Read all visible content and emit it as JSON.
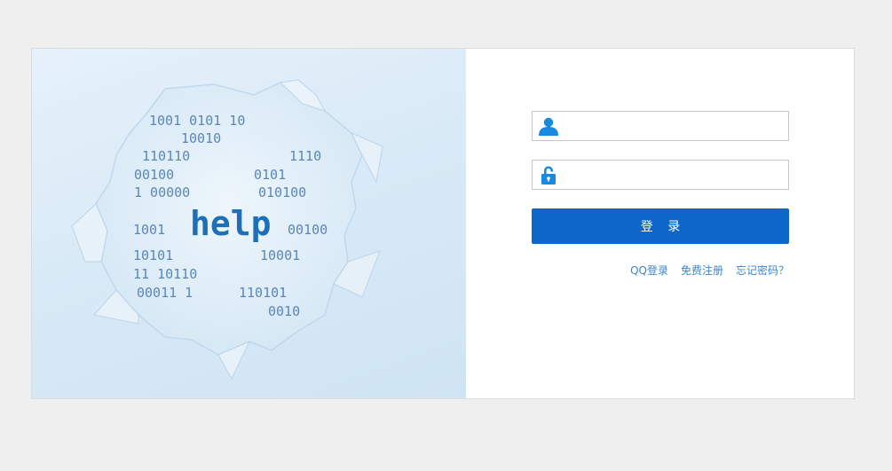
{
  "hero": {
    "help_word": "help",
    "binary_lines": [
      "1001 0101 10",
      "10010",
      "110110",
      "1110",
      "00100",
      "0101",
      "1 00000",
      "010100",
      "1001",
      "00100",
      "10101",
      "10001",
      "11 10110",
      "00011 1",
      "110101",
      "0010"
    ]
  },
  "form": {
    "username": {
      "value": "",
      "placeholder": ""
    },
    "password": {
      "value": "",
      "placeholder": ""
    },
    "login_label": "登 录",
    "links": {
      "qq_login": "QQ登录",
      "register": "免费注册",
      "forgot_password": "忘记密码？"
    }
  },
  "colors": {
    "background": "#efefef",
    "accent": "#0d67c8",
    "link": "#3a86cc",
    "icon": "#1a8ae0"
  },
  "icons": {
    "username": "user-icon",
    "password": "lock-icon"
  }
}
